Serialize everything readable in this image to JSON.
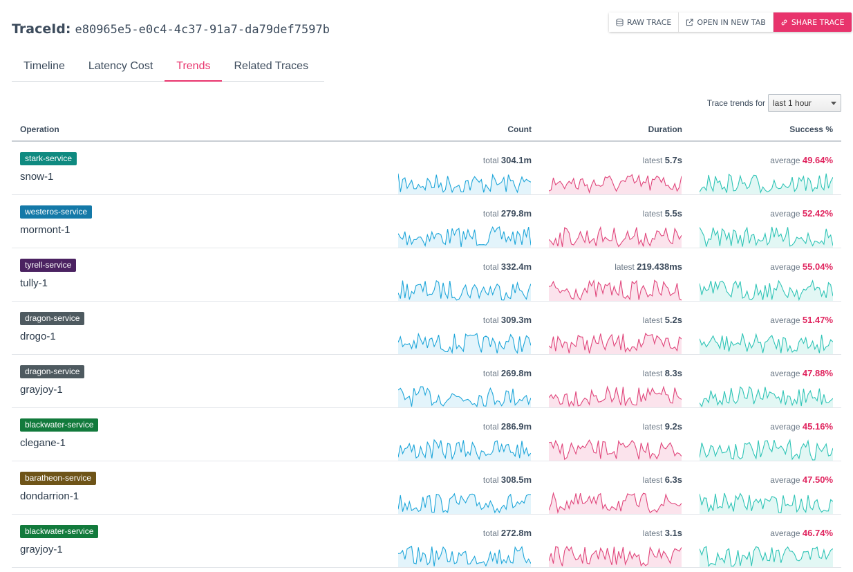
{
  "header": {
    "label": "TraceId:",
    "trace_id": "e80965e5-e0c4-4c37-91a7-da79def7597b"
  },
  "toolbar": {
    "raw_trace": "RAW TRACE",
    "open_new_tab": "OPEN IN NEW TAB",
    "share_trace": "SHARE TRACE"
  },
  "tabs": [
    {
      "label": "Timeline"
    },
    {
      "label": "Latency Cost"
    },
    {
      "label": "Trends",
      "active": true
    },
    {
      "label": "Related Traces"
    }
  ],
  "filter": {
    "label": "Trace trends for",
    "selected": "last 1 hour"
  },
  "columns": {
    "operation": "Operation",
    "count": "Count",
    "duration": "Duration",
    "success": "Success %"
  },
  "colors": {
    "accent": "#e8336c",
    "count_line": "#1ca5d9",
    "count_fill": "#e3f4fb",
    "duration_line": "#e0457b",
    "duration_fill": "#fbe3ec",
    "success_line": "#2ec4b6",
    "success_fill": "#e2f7f4"
  },
  "rows": [
    {
      "service": "stark-service",
      "color": "#0f8a80",
      "operation": "snow-1",
      "count_prefix": "total",
      "count": "304.1m",
      "duration_prefix": "latest",
      "duration": "5.7s",
      "success_prefix": "average",
      "success": "49.64%"
    },
    {
      "service": "westeros-service",
      "color": "#1479a8",
      "operation": "mormont-1",
      "count_prefix": "total",
      "count": "279.8m",
      "duration_prefix": "latest",
      "duration": "5.5s",
      "success_prefix": "average",
      "success": "52.42%"
    },
    {
      "service": "tyrell-service",
      "color": "#4b2261",
      "operation": "tully-1",
      "count_prefix": "total",
      "count": "332.4m",
      "duration_prefix": "latest",
      "duration": "219.438ms",
      "success_prefix": "average",
      "success": "55.04%"
    },
    {
      "service": "dragon-service",
      "color": "#4e5a60",
      "operation": "drogo-1",
      "count_prefix": "total",
      "count": "309.3m",
      "duration_prefix": "latest",
      "duration": "5.2s",
      "success_prefix": "average",
      "success": "51.47%"
    },
    {
      "service": "dragon-service",
      "color": "#4e5a60",
      "operation": "grayjoy-1",
      "count_prefix": "total",
      "count": "269.8m",
      "duration_prefix": "latest",
      "duration": "8.3s",
      "success_prefix": "average",
      "success": "47.88%"
    },
    {
      "service": "blackwater-service",
      "color": "#127a3c",
      "operation": "clegane-1",
      "count_prefix": "total",
      "count": "286.9m",
      "duration_prefix": "latest",
      "duration": "9.2s",
      "success_prefix": "average",
      "success": "45.16%"
    },
    {
      "service": "baratheon-service",
      "color": "#6e5418",
      "operation": "dondarrion-1",
      "count_prefix": "total",
      "count": "308.5m",
      "duration_prefix": "latest",
      "duration": "6.3s",
      "success_prefix": "average",
      "success": "47.50%"
    },
    {
      "service": "blackwater-service",
      "color": "#127a3c",
      "operation": "grayjoy-1",
      "count_prefix": "total",
      "count": "272.8m",
      "duration_prefix": "latest",
      "duration": "3.1s",
      "success_prefix": "average",
      "success": "46.74%"
    }
  ]
}
